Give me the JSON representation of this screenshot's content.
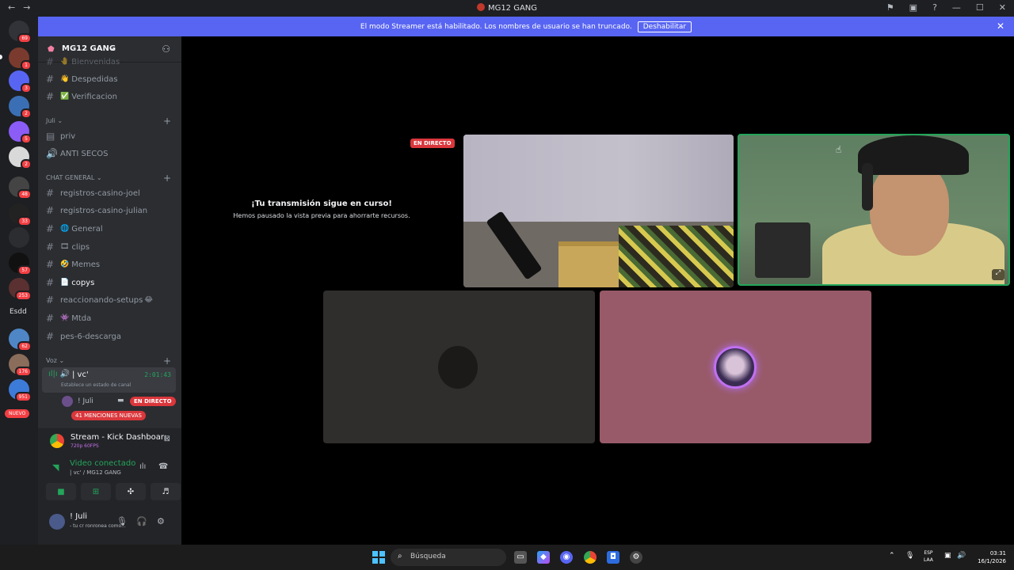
{
  "window": {
    "title": "MG12 GANG",
    "back_icon": "←",
    "forward_icon": "→",
    "right_icons": [
      "⚑",
      "▣",
      "?",
      "—",
      "☐",
      "✕"
    ]
  },
  "banner": {
    "text": "El modo Streamer está habilitado. Los nombres de usuario se han truncado.",
    "button": "Deshabilitar",
    "close": "✕"
  },
  "servers": {
    "badges": [
      "69",
      "1",
      "3",
      "2",
      "5",
      "2",
      "48",
      "33",
      "57",
      "253",
      "2",
      "62",
      "176",
      "951"
    ],
    "text_server": "Esdd",
    "nuevo": "NUEVO"
  },
  "guild": {
    "name": "MG12 GANG",
    "chevron": "⌄",
    "add_member_icon": "⚇"
  },
  "channels": [
    {
      "name": "Bienvenidas",
      "emoji": "🤚"
    },
    {
      "name": "Despedidas",
      "emoji": "👋"
    },
    {
      "name": "Verificacion",
      "emoji": "✅"
    }
  ],
  "cat_juli": {
    "name": "Juli",
    "items": [
      {
        "name": "priv",
        "icon": "▤"
      },
      {
        "name": "ANTI SECOS",
        "icon": "🔊"
      }
    ]
  },
  "cat_chat": {
    "name": "CHAT GENERAL",
    "items": [
      {
        "name": "registros-casino-joel",
        "emoji": ""
      },
      {
        "name": "registros-casino-julian",
        "emoji": ""
      },
      {
        "name": "General",
        "emoji": "🌐"
      },
      {
        "name": "clips",
        "emoji": "🎞"
      },
      {
        "name": "Memes",
        "emoji": "🤣"
      },
      {
        "name": "copys",
        "emoji": "📄"
      },
      {
        "name": "reaccionando-setups",
        "emoji": "😂"
      },
      {
        "name": "Mtda",
        "emoji": "👾"
      },
      {
        "name": "pes-6-descarga",
        "emoji": ""
      }
    ]
  },
  "cat_voz": {
    "name": "Voz",
    "channel": {
      "name": "| vc'",
      "time": "2:01:43",
      "status": "Establece un estado de canal"
    },
    "user": {
      "name": "! Juli",
      "live": "EN DIRECTO"
    },
    "mentions": "41 MENCIONES NUEVAS"
  },
  "stream_panel": {
    "title": "Stream - Kick Dashboard - Go...",
    "quality": "720p 60FPS"
  },
  "voice_panel": {
    "status": "Video conectado",
    "location": "| vc' / MG12 GANG"
  },
  "user_panel": {
    "name": "! Juli",
    "status": "- tu cr ronronea como..."
  },
  "stage": {
    "live_tag": "EN DIRECTO",
    "paused_title": "¡Tu transmisión sigue en curso!",
    "paused_sub": "Hemos pausado la vista previa para ahorrarte recursos."
  },
  "taskbar": {
    "search": "Búsqueda",
    "lang_top": "ESP",
    "lang_bottom": "LAA",
    "time": "03:31",
    "date": "16/1/2026"
  },
  "colors": {
    "accent": "#5865f2",
    "live": "#da373c",
    "connected": "#23a55a"
  }
}
